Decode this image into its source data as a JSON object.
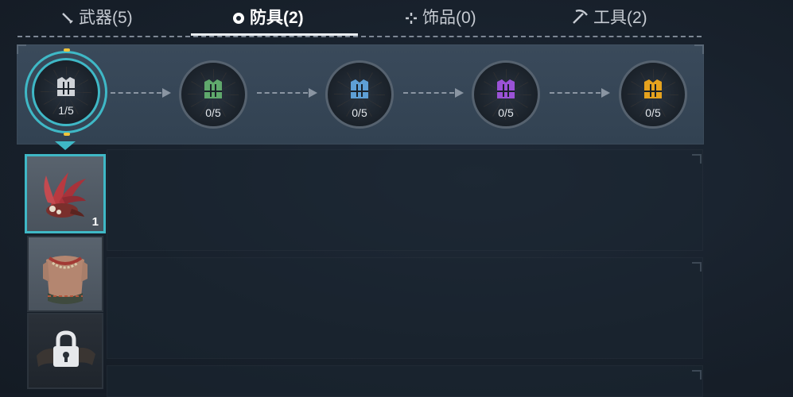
{
  "tabs": [
    {
      "label": "武器(5)",
      "icon": "sword-icon",
      "active": false
    },
    {
      "label": "防具(2)",
      "icon": "armor-icon",
      "active": true
    },
    {
      "label": "饰品(0)",
      "icon": "accessory-icon",
      "active": false
    },
    {
      "label": "工具(2)",
      "icon": "pickaxe-icon",
      "active": false
    }
  ],
  "tiers": [
    {
      "count": "1/5",
      "color": "#cfd3d8",
      "selected": true
    },
    {
      "count": "0/5",
      "color": "#5fa86c",
      "selected": false
    },
    {
      "count": "0/5",
      "color": "#5e9fd6",
      "selected": false
    },
    {
      "count": "0/5",
      "color": "#9a52d6",
      "selected": false
    },
    {
      "count": "0/5",
      "color": "#e5a21e",
      "selected": false
    }
  ],
  "items": [
    {
      "name": "red feather headdress",
      "quantity": "1",
      "selected": true,
      "locked": false
    },
    {
      "name": "tribal necklace vest",
      "quantity": "",
      "selected": false,
      "locked": false
    },
    {
      "name": "locked leather belt",
      "quantity": "",
      "selected": false,
      "locked": true
    }
  ],
  "colors": {
    "accent": "#3fb8c6",
    "marker": "#f0c43a"
  }
}
